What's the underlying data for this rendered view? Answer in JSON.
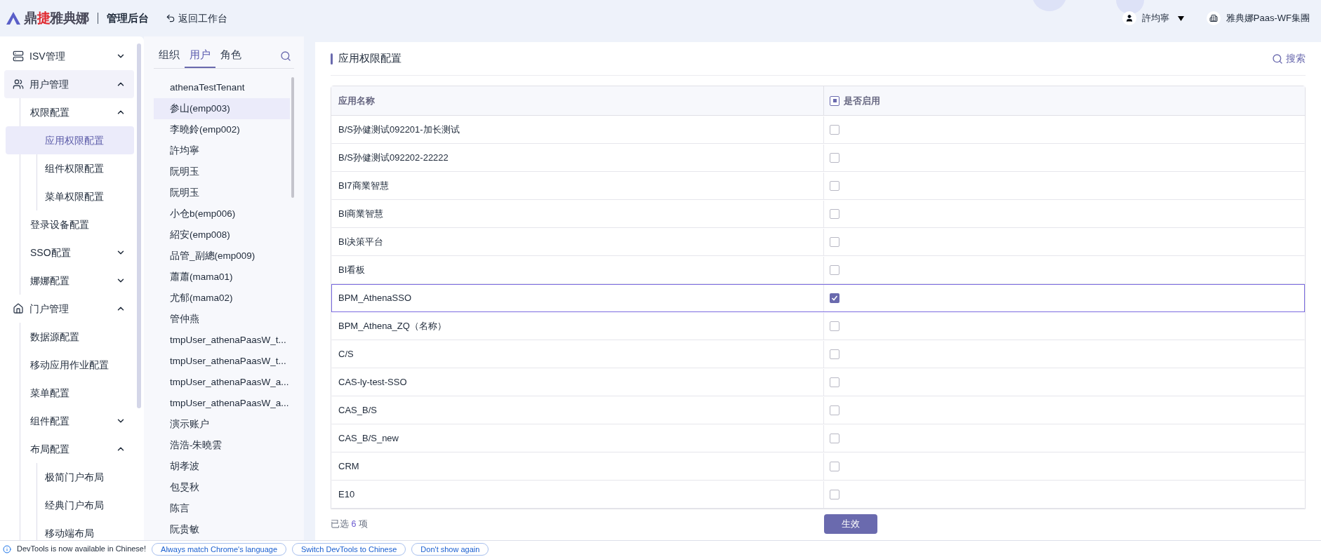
{
  "header": {
    "logo_parts": [
      {
        "text": "鼎",
        "accent": false
      },
      {
        "text": "捷",
        "accent": true
      },
      {
        "text": "雅典娜",
        "accent": false
      }
    ],
    "app_title": "管理后台",
    "back_link": "返回工作台",
    "user": "許均寧",
    "company": "雅典娜Paas-WF集團"
  },
  "sidebar": {
    "items": [
      {
        "label": "ISV管理",
        "expanded": false,
        "selected": false
      },
      {
        "label": "用户管理",
        "expanded": true,
        "selected": false,
        "children": [
          {
            "label": "权限配置",
            "expanded": true,
            "selected": false,
            "children": [
              {
                "label": "应用权限配置",
                "selected": true
              },
              {
                "label": "组件权限配置",
                "selected": false
              },
              {
                "label": "菜单权限配置",
                "selected": false
              }
            ]
          },
          {
            "label": "登录设备配置",
            "selected": false
          },
          {
            "label": "SSO配置",
            "expanded": false,
            "selected": false
          },
          {
            "label": "娜娜配置",
            "expanded": false,
            "selected": false
          }
        ]
      },
      {
        "label": "门户管理",
        "expanded": true,
        "selected": false,
        "children": [
          {
            "label": "数据源配置",
            "selected": false
          },
          {
            "label": "移动应用作业配置",
            "selected": false
          },
          {
            "label": "菜单配置",
            "selected": false
          },
          {
            "label": "组件配置",
            "expanded": false,
            "selected": false
          },
          {
            "label": "布局配置",
            "expanded": true,
            "selected": false,
            "children": [
              {
                "label": "极简门户布局",
                "selected": false
              },
              {
                "label": "经典门户布局",
                "selected": false
              },
              {
                "label": "移动端布局",
                "selected": false
              }
            ]
          }
        ]
      }
    ]
  },
  "user_panel": {
    "tabs": [
      {
        "label": "组织",
        "selected": false
      },
      {
        "label": "用户",
        "selected": true
      },
      {
        "label": "角色",
        "selected": false
      }
    ],
    "users": [
      {
        "name": "athenaTestTenant",
        "selected": false
      },
      {
        "name": "参山(emp003)",
        "selected": true
      },
      {
        "name": "李曉鈴(emp002)",
        "selected": false
      },
      {
        "name": "許均寧",
        "selected": false
      },
      {
        "name": "阮明玉",
        "selected": false
      },
      {
        "name": "阮明玉",
        "selected": false
      },
      {
        "name": "小仓b(emp006)",
        "selected": false
      },
      {
        "name": "紹安(emp008)",
        "selected": false
      },
      {
        "name": "品管_副總(emp009)",
        "selected": false
      },
      {
        "name": "蕭蕭(mama01)",
        "selected": false
      },
      {
        "name": "尤郁(mama02)",
        "selected": false
      },
      {
        "name": "管仲燕",
        "selected": false
      },
      {
        "name": "tmpUser_athenaPaasW_t...",
        "selected": false
      },
      {
        "name": "tmpUser_athenaPaasW_t...",
        "selected": false
      },
      {
        "name": "tmpUser_athenaPaasW_a...",
        "selected": false
      },
      {
        "name": "tmpUser_athenaPaasW_a...",
        "selected": false
      },
      {
        "name": "演示账户",
        "selected": false
      },
      {
        "name": "浩浩-朱曉雲",
        "selected": false
      },
      {
        "name": "胡孝波",
        "selected": false
      },
      {
        "name": "包旻秋",
        "selected": false
      },
      {
        "name": "陈言",
        "selected": false
      },
      {
        "name": "阮贵敏",
        "selected": false
      }
    ]
  },
  "content": {
    "title": "应用权限配置",
    "search": "搜索",
    "table": {
      "columns": [
        {
          "label": "应用名称"
        },
        {
          "label": "是否启用",
          "indeterminate": true
        }
      ],
      "rows": [
        {
          "name": "B/S孙健测试092201-加长测试",
          "checked": false,
          "selected": false
        },
        {
          "name": "B/S孙健测试092202-22222",
          "checked": false,
          "selected": false
        },
        {
          "name": "BI7商業智慧",
          "checked": false,
          "selected": false
        },
        {
          "name": "BI商業智慧",
          "checked": false,
          "selected": false
        },
        {
          "name": "BI决策平台",
          "checked": false,
          "selected": false
        },
        {
          "name": "BI看板",
          "checked": false,
          "selected": false
        },
        {
          "name": "BPM_AthenaSSO",
          "checked": true,
          "selected": true
        },
        {
          "name": "BPM_Athena_ZQ（名称）",
          "checked": false,
          "selected": false
        },
        {
          "name": "C/S",
          "checked": false,
          "selected": false
        },
        {
          "name": "CAS-ly-test-SSO",
          "checked": false,
          "selected": false
        },
        {
          "name": "CAS_B/S",
          "checked": false,
          "selected": false
        },
        {
          "name": "CAS_B/S_new",
          "checked": false,
          "selected": false
        },
        {
          "name": "CRM",
          "checked": false,
          "selected": false
        },
        {
          "name": "E10",
          "checked": false,
          "selected": false
        }
      ]
    },
    "footer": {
      "selected_prefix": "已选",
      "selected_count": "6",
      "selected_suffix": "项",
      "apply_button": "生效"
    }
  },
  "devtools_bar": {
    "message": "DevTools is now available in Chinese!",
    "buttons": [
      "Always match Chrome's language",
      "Switch DevTools to Chinese",
      "Don't show again"
    ]
  }
}
